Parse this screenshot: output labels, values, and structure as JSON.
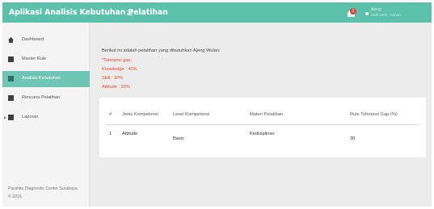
{
  "header": {
    "app_title": "Aplikasi Analisis Kebutuhan Pelatihan",
    "notification_count": "2",
    "user_name": "Ajeng",
    "user_role": "Staff HRD · Admin"
  },
  "sidebar": {
    "items": [
      {
        "label": "Dashboard",
        "icon": "home-icon"
      },
      {
        "label": "Master Rule",
        "icon": "document-icon"
      },
      {
        "label": "Analisis Kebutuhan",
        "icon": "chart-icon"
      },
      {
        "label": "Rencana Pelatihan",
        "icon": "clipboard-icon"
      },
      {
        "label": "Laporan",
        "icon": "report-icon"
      }
    ],
    "active_index": 2,
    "footer_line1": "Parahita Diagnostic Center Surabaya",
    "footer_line2": "© 2016"
  },
  "main": {
    "intro": "Berikut ini adalah pelatihan yang dibutuhkan Ajeng Wulan:",
    "tolerance_lines": [
      "*Toleransi gap:",
      "Knowledge : 40%",
      "Skill : 30%",
      "Attitude : 30%"
    ],
    "table": {
      "columns": [
        "#",
        "Jenis Kompetensi",
        "Level Kompetensi",
        "Materi Pelatihan",
        "Rule Toleransi Gap (%)"
      ],
      "rows": [
        {
          "no": "1",
          "jenis": "Attitude",
          "level": "Basic",
          "materi": "Kedisiplinan",
          "gap": "30"
        }
      ]
    }
  },
  "colors": {
    "accent": "#5bc1aa",
    "active_nav": "#6ec5b4",
    "warning_text": "#e04a3a",
    "badge": "#d9463b"
  }
}
